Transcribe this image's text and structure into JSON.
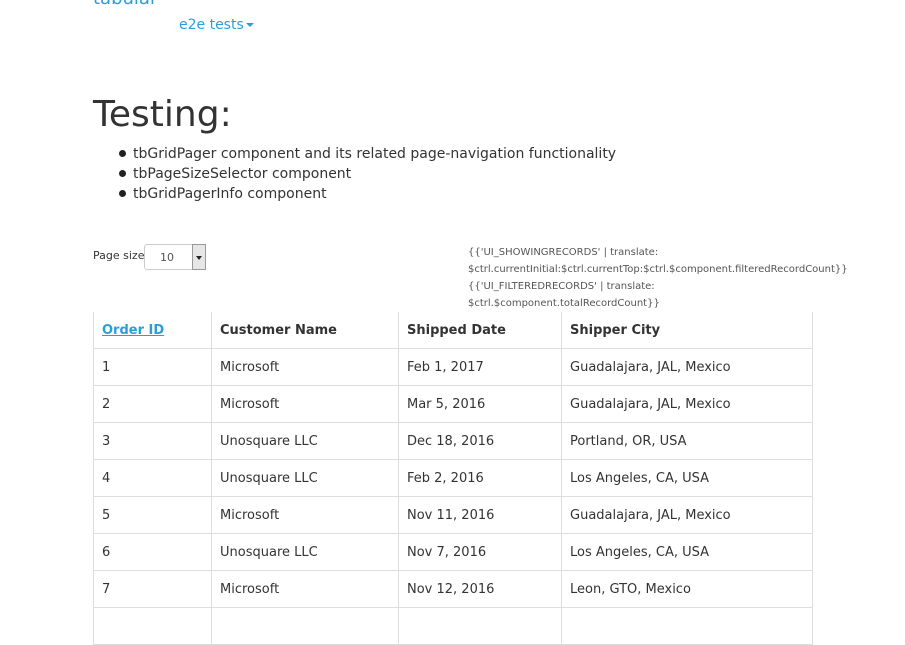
{
  "brand": "tabular",
  "nav": {
    "dropdown_label": "e2e tests"
  },
  "page_title": "Testing:",
  "features": [
    "tbGridPager component and its related page-navigation functionality",
    "tbPageSizeSelector component",
    "tbGridPagerInfo component"
  ],
  "page_size": {
    "label": "Page size:",
    "value": "10"
  },
  "pager_info": {
    "line1a": "{{'UI_SHOWINGRECORDS' | translate:",
    "line1b": "$ctrl.currentInitial:$ctrl.currentTop:$ctrl.$component.filteredRecordCount}}",
    "line2a": "{{'UI_FILTEREDRECORDS' | translate:",
    "line2b": "$ctrl.$component.totalRecordCount}}"
  },
  "table": {
    "headers": [
      "Order ID",
      "Customer Name",
      "Shipped Date",
      "Shipper City"
    ],
    "rows": [
      [
        "1",
        "Microsoft",
        "Feb 1, 2017",
        "Guadalajara, JAL, Mexico"
      ],
      [
        "2",
        "Microsoft",
        "Mar 5, 2016",
        "Guadalajara, JAL, Mexico"
      ],
      [
        "3",
        "Unosquare LLC",
        "Dec 18, 2016",
        "Portland, OR, USA"
      ],
      [
        "4",
        "Unosquare LLC",
        "Feb 2, 2016",
        "Los Angeles, CA, USA"
      ],
      [
        "5",
        "Microsoft",
        "Nov 11, 2016",
        "Guadalajara, JAL, Mexico"
      ],
      [
        "6",
        "Unosquare LLC",
        "Nov 7, 2016",
        "Los Angeles, CA, USA"
      ],
      [
        "7",
        "Microsoft",
        "Nov 12, 2016",
        "Leon, GTO, Mexico"
      ],
      [
        "",
        "",
        "",
        ""
      ]
    ]
  },
  "colors": {
    "link": "#2a9fd6",
    "text": "#333333",
    "border": "#dddddd"
  }
}
